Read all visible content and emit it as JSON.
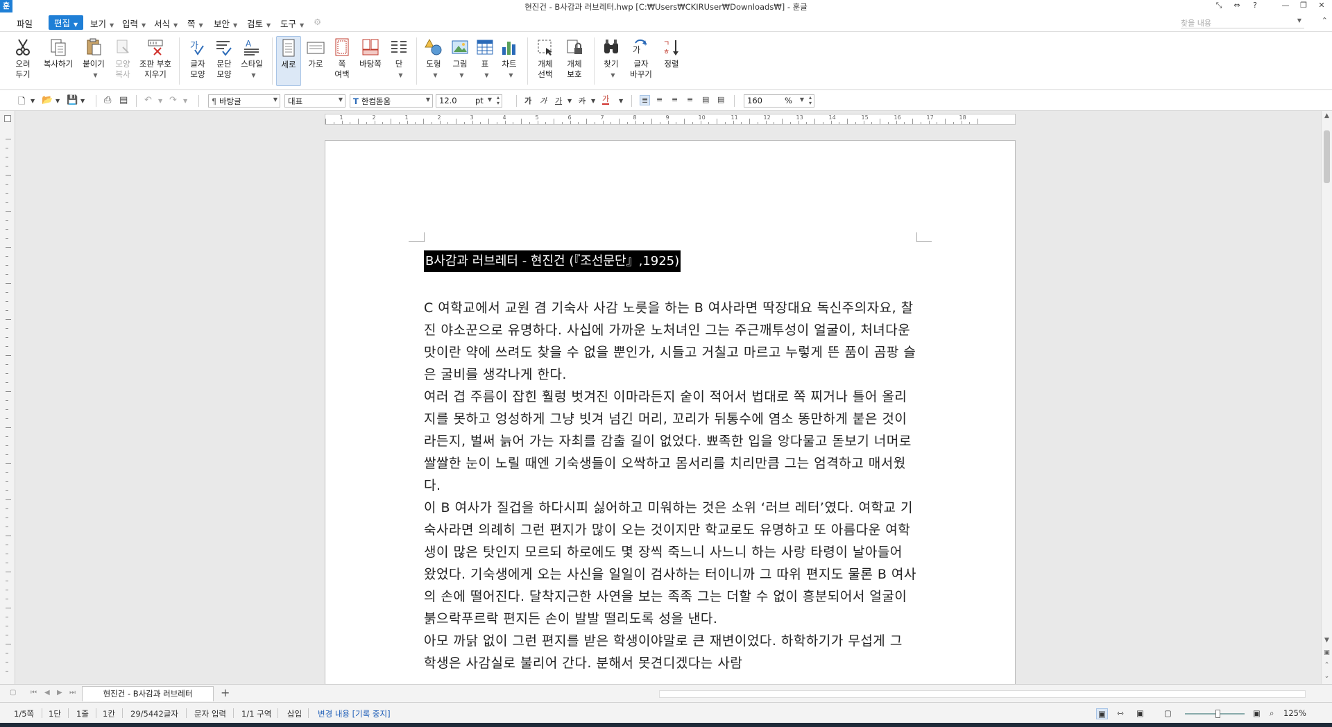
{
  "window": {
    "title": "현진건 - B사감과 러브레터.hwp [C:₩Users₩CKIRUser₩Downloads₩] - 훈글",
    "app_logo": "훈",
    "controls": [
      "restore-icon",
      "resize-icon",
      "?",
      "minimize-icon",
      "maximize-icon",
      "close-icon"
    ]
  },
  "menu": {
    "items": [
      "파일",
      "편집",
      "보기",
      "입력",
      "서식",
      "쪽",
      "보안",
      "검토",
      "도구"
    ],
    "active": "편집",
    "find_placeholder": "찾을 내용"
  },
  "ribbon": {
    "cut": "오려\n두기",
    "copy": "복사하기",
    "paste": "붙이기",
    "format_copy": "모양\n복사",
    "clear_marks": "조판 부호\n지우기",
    "char_shape": "글자\n모양",
    "para_shape": "문단\n모양",
    "style": "스타일",
    "portrait": "세로",
    "landscape": "가로",
    "page_margin": "쪽\n여백",
    "background": "바탕쪽",
    "columns": "단",
    "shapes": "도형",
    "picture": "그림",
    "table": "표",
    "chart": "차트",
    "object_select": "개체\n선택",
    "object_protect": "개체\n보호",
    "find": "찾기",
    "replace": "글자\n바꾸기",
    "sort": "정렬"
  },
  "format_bar": {
    "style_name": "바탕글",
    "lang": "대표",
    "font": "한컴돋움",
    "font_size": "12.0",
    "size_unit": "pt",
    "zoom": "160",
    "zoom_unit": "%",
    "bold": "가",
    "italic": "가",
    "underline": "가",
    "strike": "가",
    "color": "가"
  },
  "document": {
    "title": "B사감과 러브레터 - 현진건 (『조선문단』,1925)",
    "paragraphs": [
      " C 여학교에서 교원 겸 기숙사 사감 노릇을 하는 B 여사라면 딱장대요 독신주의자요, 찰진 야소꾼으로 유명하다. 사십에 가까운 노처녀인 그는 주근깨투성이 얼굴이, 처녀다운 맛이란 약에 쓰려도 찾을 수 없을 뿐인가, 시들고 거칠고 마르고 누렇게 뜬 품이 곰팡 슬은 굴비를 생각나게 한다.",
      " 여러 겹 주름이 잡힌 훨렁 벗겨진 이마라든지 숱이 적어서 법대로 쪽 찌거나 틀어 올리지를 못하고 엉성하게 그냥 빗겨 넘긴 머리, 꼬리가 뒤통수에 염소 똥만하게 붙은 것이라든지, 벌써 늙어 가는 자최를 감출 길이 없었다. 뾰족한 입을 앙다물고 돋보기 너머로 쌀쌀한 눈이 노릴 때엔 기숙생들이 오싹하고 몸서리를 치리만큼 그는 엄격하고 매서웠다.",
      " 이 B 여사가 질겁을 하다시피 싫어하고 미워하는 것은 소위 ‘러브 레터’였다. 여학교 기숙사라면 의례히 그런 편지가 많이 오는 것이지만 학교로도 유명하고 또 아름다운 여학생이 많은 탓인지 모르되 하로에도 몇 장씩 죽느니 사느니 하는 사랑 타령이 날아들어 왔었다. 기숙생에게 오는 사신을 일일이 검사하는 터이니까 그 따위 편지도 물론 B 여사의 손에 떨어진다. 달착지근한 사연을 보는 족족 그는 더할 수 없이 흥분되어서 얼굴이 붉으락푸르락 편지든 손이 발발 떨리도록 성을 낸다.",
      " 아모 까닭 없이 그런 편지를 받은 학생이야말로 큰 재변이었다. 하학하기가 무섭게 그 학생은 사감실로 불리어 간다. 분해서 못견디겠다는 사람"
    ]
  },
  "ruler_numbers": [
    "1",
    "2",
    "1",
    "2",
    "3",
    "4",
    "5",
    "6",
    "7",
    "8",
    "9",
    "10",
    "11",
    "12",
    "13",
    "14",
    "15",
    "16",
    "17",
    "18"
  ],
  "tabs": {
    "active": "현진건 - B사감과 러브레터",
    "add": "+"
  },
  "status": {
    "page": "1/5쪽",
    "column": "1단",
    "line": "1줄",
    "col": "1칸",
    "chars": "29/5442글자",
    "mode": "문자 입력",
    "section": "1/1 구역",
    "insert": "삽입",
    "track": "변경 내용 [기록 중지]",
    "zoom": "125%"
  }
}
